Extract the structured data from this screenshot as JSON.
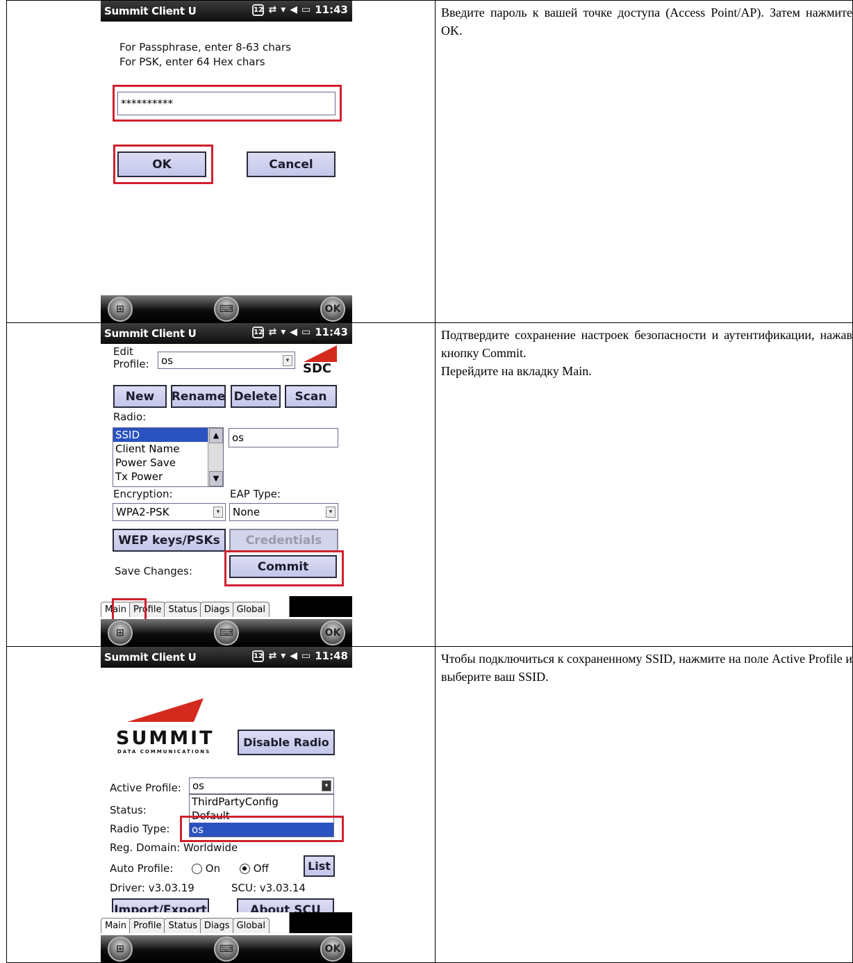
{
  "rows": [
    {
      "text": [
        "Введите пароль к вашей точке доступа (Access Point/AP). Затем нажмите OK."
      ],
      "screen": {
        "title": "Summit Client U",
        "badge": "12",
        "time": "11:43",
        "hint_line1": "For Passphrase, enter 8-63 chars",
        "hint_line2": "For PSK, enter 64 Hex chars",
        "password_value": "**********",
        "ok_label": "OK",
        "cancel_label": "Cancel",
        "softkey_right": "OK"
      }
    },
    {
      "text": [
        "Подтвердите сохранение настроек безопасности и аутентификации, нажав кнопку Commit.",
        "Перейдите на вкладку Main."
      ],
      "screen": {
        "title": "Summit Client U",
        "badge": "12",
        "time": "11:43",
        "edit_label_1": "Edit",
        "edit_label_2": "Profile:",
        "profile_value": "os",
        "logo_text": "SDC",
        "buttons": [
          "New",
          "Rename",
          "Delete",
          "Scan"
        ],
        "radio_label": "Radio:",
        "radio_list": [
          "SSID",
          "Client Name",
          "Power Save",
          "Tx Power"
        ],
        "ssid_value": "os",
        "encryption_label": "Encryption:",
        "eap_label": "EAP Type:",
        "encryption_value": "WPA2-PSK",
        "eap_value": "None",
        "wep_label": "WEP keys/PSKs",
        "credentials_label": "Credentials",
        "save_label": "Save Changes:",
        "commit_label": "Commit",
        "tabs": [
          "Main",
          "Profile",
          "Status",
          "Diags",
          "Global"
        ],
        "softkey_right": "OK"
      }
    },
    {
      "text": [
        "Чтобы подключиться к сохраненному SSID, нажмите на поле Active Profile и выберите ваш SSID."
      ],
      "screen": {
        "title": "Summit Client U",
        "badge": "12",
        "time": "11:48",
        "logo_main": "SUMMIT",
        "logo_sub": "DATA COMMUNICATIONS",
        "disable_radio": "Disable Radio",
        "active_profile_label": "Active Profile:",
        "active_profile_value": "os",
        "dropdown_options": [
          "ThirdPartyConfig",
          "Default",
          "os"
        ],
        "status_label": "Status:",
        "radio_type_label": "Radio Type:",
        "reg_domain": "Reg. Domain:  Worldwide",
        "auto_profile_label": "Auto Profile:",
        "on_label": "On",
        "off_label": "Off",
        "list_label": "List",
        "driver_text": "Driver:  v3.03.19",
        "scu_text": "SCU: v3.03.14",
        "import_export": "Import/Export",
        "about_scu": "About SCU",
        "tabs": [
          "Main",
          "Profile",
          "Status",
          "Diags",
          "Global"
        ],
        "softkey_right": "OK"
      }
    }
  ],
  "colors": {
    "highlight": "#d0202e",
    "button_face": "#c8caee",
    "selection": "#2a52c0"
  }
}
